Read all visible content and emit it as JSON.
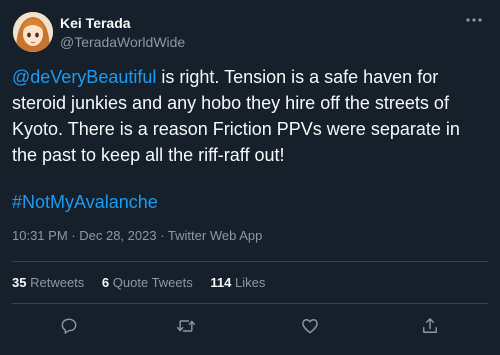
{
  "author": {
    "name": "Kei Terada",
    "handle": "@TeradaWorldWide"
  },
  "tweet": {
    "lines": [
      {
        "mention": "@deVeryBeautiful",
        "text": " is right. Tension is a safe haven for"
      },
      {
        "text": "steroid junkies and any hobo they hire off the streets of"
      },
      {
        "text": "Kyoto. There is a reason Friction PPVs were separate in"
      },
      {
        "text": "the past to keep all the riff-raff out!"
      }
    ],
    "hashtag": "#NotMyAvalanche"
  },
  "meta": {
    "time": "10:31 PM",
    "date": "Dec 28, 2023",
    "source": "Twitter Web App"
  },
  "stats": {
    "retweets": {
      "count": "35",
      "label": "Retweets"
    },
    "quote_tweets": {
      "count": "6",
      "label": "Quote Tweets"
    },
    "likes": {
      "count": "114",
      "label": "Likes"
    }
  },
  "icons": {
    "more": "more-icon",
    "reply": "reply-icon",
    "retweet": "retweet-icon",
    "like": "like-icon",
    "share": "share-icon"
  },
  "colors": {
    "background": "#15202b",
    "text": "#f7f9f9",
    "secondary": "#8b98a5",
    "accent": "#1d9bf0",
    "divider": "#38444d"
  }
}
